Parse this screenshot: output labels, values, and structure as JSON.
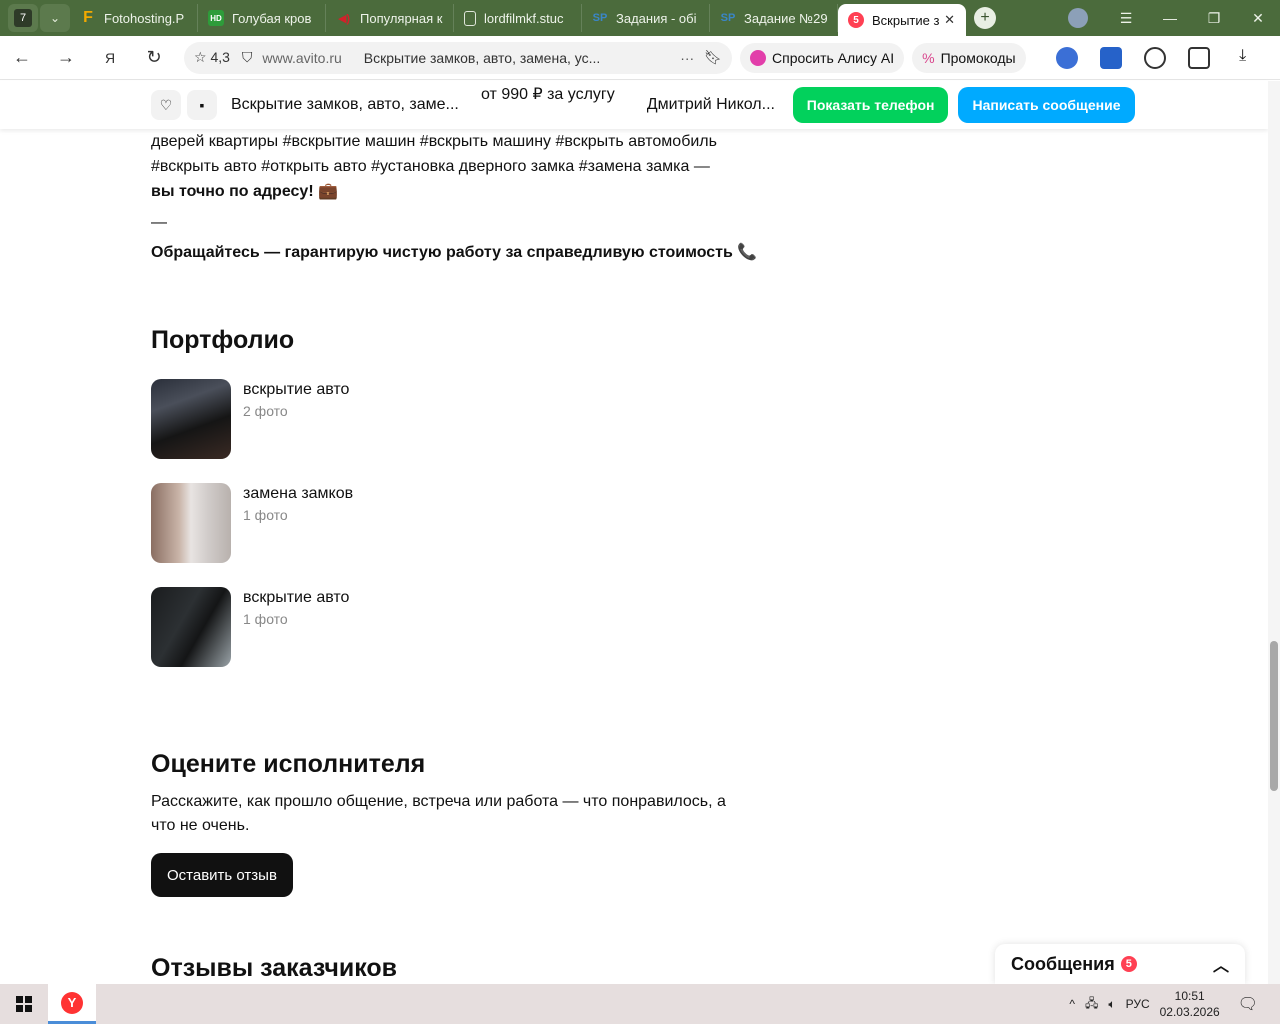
{
  "browser": {
    "tab_count": "7",
    "tabs": [
      {
        "label": "Fotohosting.P",
        "fav_text": "F",
        "fav_color": "#f2a900"
      },
      {
        "label": "Голубая кров",
        "fav_text": "HD",
        "fav_color": "#2e9c3a"
      },
      {
        "label": "Популярная к",
        "fav_text": "◀)",
        "fav_color": "#c0202a"
      },
      {
        "label": "lordfilmkf.stuc",
        "fav_text": "▯",
        "fav_color": "#dfe6da"
      },
      {
        "label": "Задания - обі",
        "fav_text": "SP",
        "fav_color": "#3a86c8"
      },
      {
        "label": "Задание №29",
        "fav_text": "SP",
        "fav_color": "#3a86c8"
      }
    ],
    "active_tab": {
      "label": "Вскрытие з",
      "badge": "5"
    },
    "rating": "4,3",
    "domain": "www.avito.ru",
    "page_title": "Вскрытие замков, авто, замена, ус...",
    "alice_label": "Спросить Алису AI",
    "promo_label": "Промокоды"
  },
  "sticky": {
    "title": "Вскрытие замков, авто, заме...",
    "price": "от 990 ₽ за услугу",
    "seller": "Дмитрий Никол...",
    "show_phone": "Показать телефон",
    "write_message": "Написать сообщение"
  },
  "description": {
    "line1": "дверей квартиры #вскрытие машин #вскрыть машину #вскрыть автомобиль",
    "line2": "#вскрыть авто #открыть авто #установка дверного замка #замена замка —",
    "line3": "вы точно по адресу! 💼",
    "dash": "—",
    "cta": "Обращайтесь — гарантирую чистую работу за справедливую стоимость 📞"
  },
  "portfolio": {
    "title": "Портфолио",
    "items": [
      {
        "name": "вскрытие авто",
        "count": "2 фото"
      },
      {
        "name": "замена замков",
        "count": "1 фото"
      },
      {
        "name": "вскрытие авто",
        "count": "1 фото"
      }
    ]
  },
  "rating_section": {
    "title": "Оцените исполнителя",
    "text": "Расскажите, как прошло общение, встреча или работа — что понравилось, а что не очень.",
    "button": "Оставить отзыв"
  },
  "reviews": {
    "title": "Отзывы заказчиков"
  },
  "messages": {
    "label": "Сообщения",
    "count": "5"
  },
  "taskbar": {
    "lang": "РУС",
    "time": "10:51",
    "date": "02.03.2026"
  },
  "colors": {
    "green": "#02d15c",
    "blue": "#00aaff",
    "tabbar": "#4b6b3c"
  }
}
